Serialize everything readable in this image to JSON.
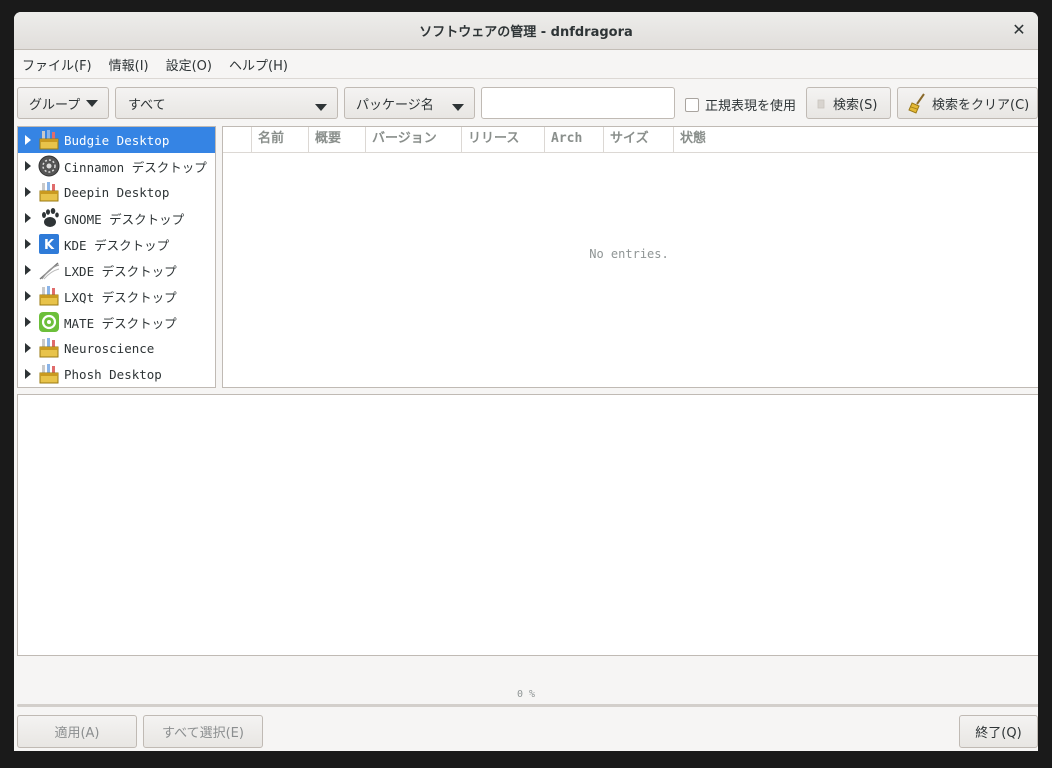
{
  "window": {
    "title": "ソフトウェアの管理 - dnfdragora"
  },
  "menubar": [
    "ファイル(F)",
    "情報(I)",
    "設定(O)",
    "ヘルプ(H)"
  ],
  "toolbar": {
    "view_combo": "グループ",
    "filter_combo": "すべて",
    "field_combo": "パッケージ名",
    "search_value": "",
    "regex_label": "正規表現を使用",
    "regex_checked": false,
    "search_button": "検索(S)",
    "clear_button": "検索をクリア(C)"
  },
  "groups": [
    {
      "label": "Budgie Desktop",
      "icon": "toolbox-icon",
      "selected": true
    },
    {
      "label": "Cinnamon デスクトップ",
      "icon": "cinnamon-icon",
      "selected": false
    },
    {
      "label": "Deepin Desktop",
      "icon": "toolbox-icon",
      "selected": false
    },
    {
      "label": "GNOME デスクトップ",
      "icon": "gnome-foot-icon",
      "selected": false
    },
    {
      "label": "KDE デスクトップ",
      "icon": "kde-icon",
      "selected": false
    },
    {
      "label": "LXDE デスクトップ",
      "icon": "lxde-icon",
      "selected": false
    },
    {
      "label": "LXQt デスクトップ",
      "icon": "toolbox-icon",
      "selected": false
    },
    {
      "label": "MATE デスクトップ",
      "icon": "mate-icon",
      "selected": false
    },
    {
      "label": "Neuroscience",
      "icon": "toolbox-icon",
      "selected": false
    },
    {
      "label": "Phosh Desktop",
      "icon": "toolbox-icon",
      "selected": false
    }
  ],
  "package_table": {
    "columns": [
      "名前",
      "概要",
      "バージョン",
      "リリース",
      "Arch",
      "サイズ",
      "状態"
    ],
    "empty_text": "No entries."
  },
  "progress": {
    "label": "0 %",
    "value": 0
  },
  "footer": {
    "apply_button": "適用(A)",
    "select_all_button": "すべて選択(E)",
    "quit_button": "終了(Q)"
  },
  "colors": {
    "accent": "#3584e4"
  }
}
